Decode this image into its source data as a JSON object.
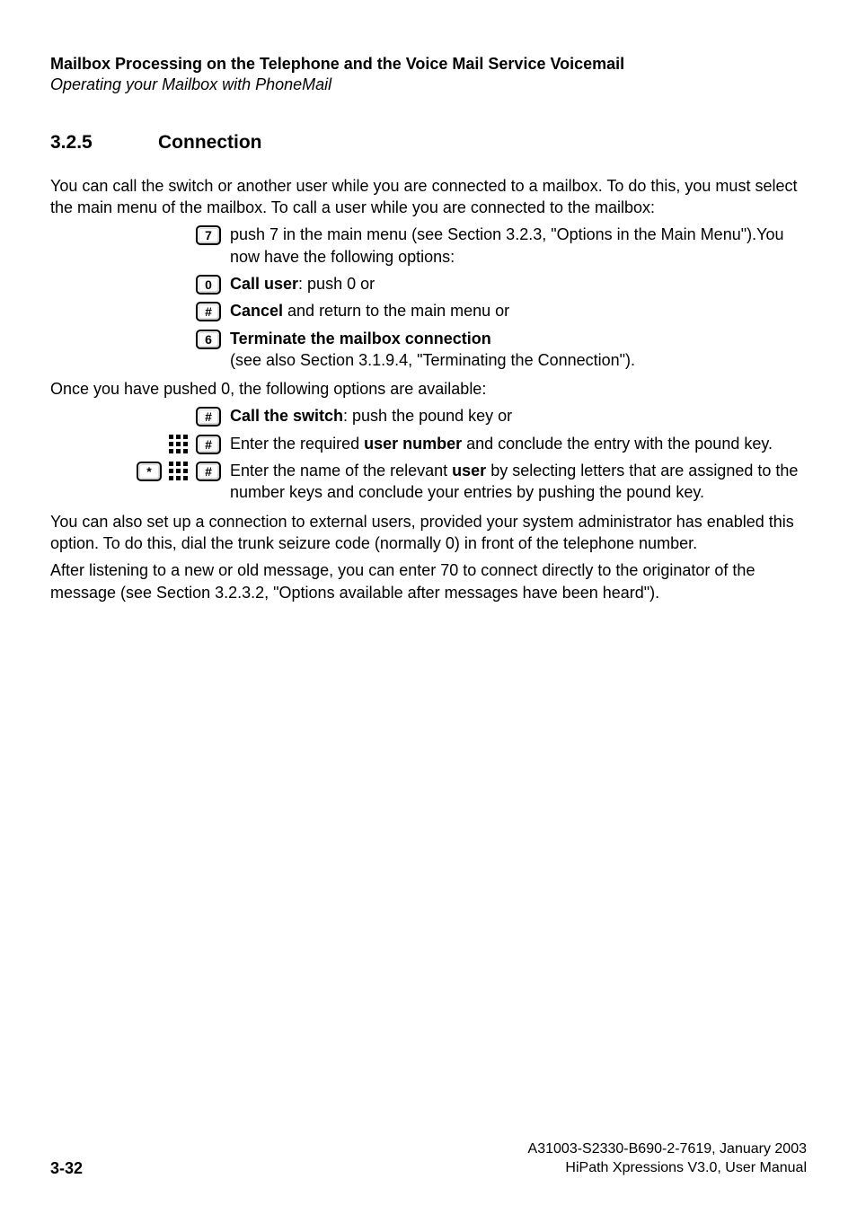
{
  "header": {
    "title_bold": "Mailbox Processing on the Telephone and the Voice Mail Service Voicemail",
    "subtitle_italic": "Operating your Mailbox with PhoneMail"
  },
  "section": {
    "number": "3.2.5",
    "title": "Connection"
  },
  "intro": "You can call the switch or another user while you are connected to a mailbox. To do this, you must select the main menu of the mailbox. To call a user while you are connected to the mailbox:",
  "steps_a": [
    {
      "keys": [
        "7"
      ],
      "text_parts": [
        {
          "t": "push 7 in the main menu (see Section 3.2.3, \"Options in the Main Menu\")."
        },
        {
          "t": "You now have the following options:"
        }
      ]
    },
    {
      "keys": [
        "0"
      ],
      "text_parts": [
        {
          "b": "Call user"
        },
        {
          "t": ": push 0 or"
        }
      ]
    },
    {
      "keys": [
        "#"
      ],
      "text_parts": [
        {
          "b": "Cancel"
        },
        {
          "t": " and return to the main menu or"
        }
      ]
    },
    {
      "keys": [
        "6"
      ],
      "text_parts": [
        {
          "b": "Terminate the mailbox connection"
        },
        {
          "br": true
        },
        {
          "t": "(see also Section 3.1.9.4, \"Terminating the Connection\")."
        }
      ]
    }
  ],
  "mid_line": " Once you have pushed 0, the following options are available:",
  "steps_b": [
    {
      "keys": [
        "#"
      ],
      "text_parts": [
        {
          "b": "Call the switch"
        },
        {
          "t": ": push the pound key or"
        }
      ]
    },
    {
      "prefix_icons": [
        "keypad"
      ],
      "keys": [
        "#"
      ],
      "text_parts": [
        {
          "t": "Enter the required "
        },
        {
          "b": "user number"
        },
        {
          "t": " and conclude the entry with the pound key."
        }
      ]
    },
    {
      "prefix_keys": [
        "*"
      ],
      "prefix_icons": [
        "keypad"
      ],
      "keys": [
        "#"
      ],
      "text_parts": [
        {
          "t": "Enter the name of the relevant "
        },
        {
          "b": "user"
        },
        {
          "t": " by selecting letters that are assigned to the number keys and conclude your entries by pushing the pound key."
        }
      ]
    }
  ],
  "closing": [
    "You can also set up a connection to external users, provided your system administrator has enabled this option. To do this, dial the trunk seizure code (normally 0) in front of the telephone number.",
    "After listening to a new or old message, you can enter 70 to connect directly to the originator of the message  (see Section 3.2.3.2, \"Options available after messages have been heard\")."
  ],
  "footer": {
    "page": "3-32",
    "doc_id": "A31003-S2330-B690-2-7619, January 2003",
    "product": "HiPath Xpressions V3.0, User Manual"
  }
}
